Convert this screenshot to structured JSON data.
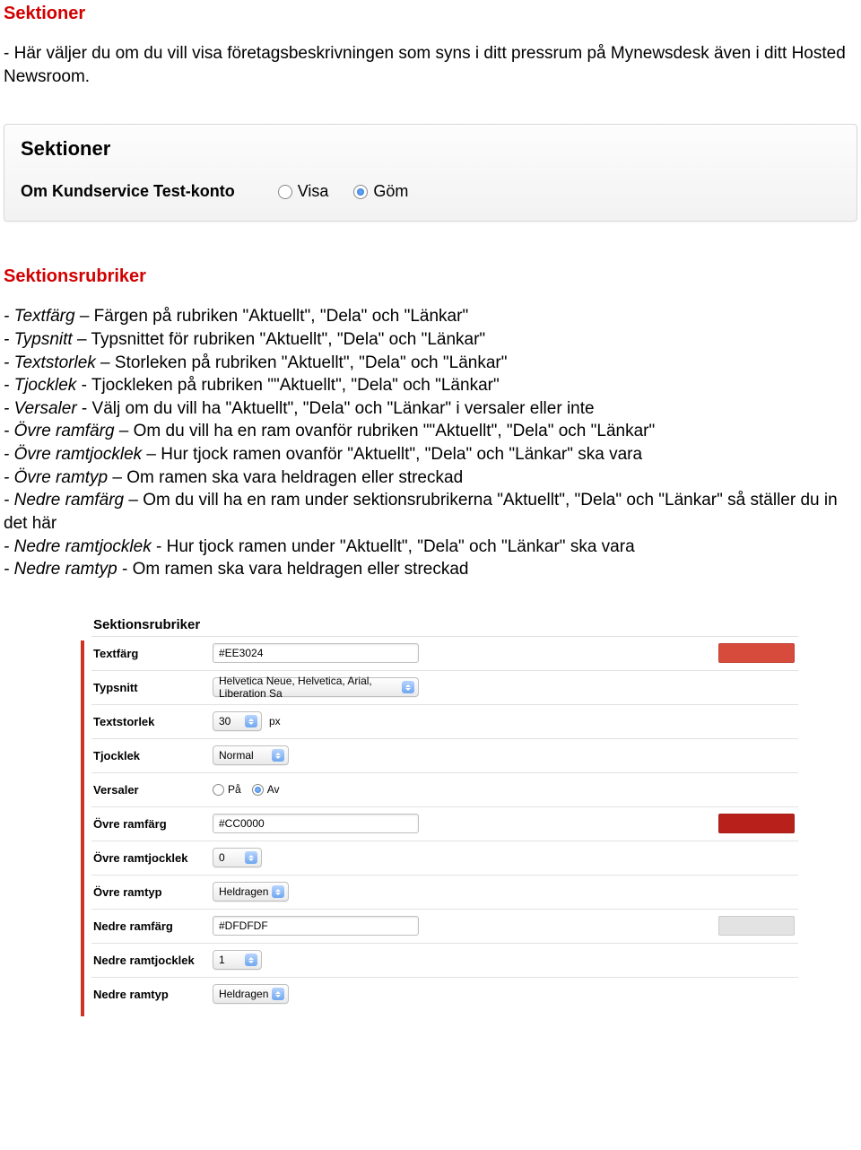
{
  "sec1": {
    "title": "Sektioner",
    "desc": "- Här väljer du om du vill visa företagsbeskrivningen som syns i ditt pressrum på Mynewsdesk även i ditt Hosted Newsroom."
  },
  "panel1": {
    "title": "Sektioner",
    "label": "Om Kundservice Test-konto",
    "opt_visa": "Visa",
    "opt_gom": "Göm"
  },
  "sec2": {
    "title": "Sektionsrubriker",
    "items": [
      {
        "term": "- Textfärg",
        "body": " – Färgen på rubriken \"Aktuellt\", \"Dela\" och \"Länkar\""
      },
      {
        "term": "- Typsnitt",
        "body": " – Typsnittet för rubriken \"Aktuellt\", \"Dela\" och \"Länkar\""
      },
      {
        "term": "- Textstorlek",
        "body": " – Storleken på  rubriken \"Aktuellt\", \"Dela\" och \"Länkar\""
      },
      {
        "term": "- Tjocklek",
        "body": " - Tjockleken på rubriken \"\"Aktuellt\", \"Dela\" och \"Länkar\""
      },
      {
        "term": "- Versaler",
        "body": " - Välj om du vill ha \"Aktuellt\", \"Dela\" och \"Länkar\" i versaler eller inte"
      },
      {
        "term": "- Övre ramfärg",
        "body": " – Om du vill ha en ram ovanför rubriken \"\"Aktuellt\", \"Dela\" och \"Länkar\""
      },
      {
        "term": "- Övre ramtjocklek",
        "body": " – Hur tjock ramen ovanför \"Aktuellt\", \"Dela\" och \"Länkar\" ska vara"
      },
      {
        "term": "- Övre ramtyp",
        "body": " – Om ramen ska vara heldragen eller streckad"
      },
      {
        "term": "- Nedre ramfärg",
        "body": " – Om du vill ha en ram under sektionsrubrikerna \"Aktuellt\", \"Dela\" och \"Länkar\" så ställer du in det här"
      },
      {
        "term": "- Nedre ramtjocklek",
        "body": " - Hur tjock ramen under \"Aktuellt\", \"Dela\" och \"Länkar\" ska vara"
      },
      {
        "term": "- Nedre ramtyp",
        "body": " - Om ramen ska vara heldragen eller streckad"
      }
    ]
  },
  "form": {
    "title": "Sektionsrubriker",
    "textfarg": {
      "label": "Textfärg",
      "value": "#EE3024",
      "swatch": "#d64b3b"
    },
    "typsnitt": {
      "label": "Typsnitt",
      "value": "Helvetica Neue, Helvetica, Arial, Liberation Sa"
    },
    "textstorlek": {
      "label": "Textstorlek",
      "value": "30",
      "unit": "px"
    },
    "tjocklek": {
      "label": "Tjocklek",
      "value": "Normal"
    },
    "versaler": {
      "label": "Versaler",
      "opt_on": "På",
      "opt_off": "Av"
    },
    "ovre_ramfarg": {
      "label": "Övre ramfärg",
      "value": "#CC0000",
      "swatch": "#b8211b"
    },
    "ovre_ramtjocklek": {
      "label": "Övre ramtjocklek",
      "value": "0"
    },
    "ovre_ramtyp": {
      "label": "Övre ramtyp",
      "value": "Heldragen"
    },
    "nedre_ramfarg": {
      "label": "Nedre ramfärg",
      "value": "#DFDFDF",
      "swatch": "#e3e3e3"
    },
    "nedre_ramtjocklek": {
      "label": "Nedre ramtjocklek",
      "value": "1"
    },
    "nedre_ramtyp": {
      "label": "Nedre ramtyp",
      "value": "Heldragen"
    }
  }
}
